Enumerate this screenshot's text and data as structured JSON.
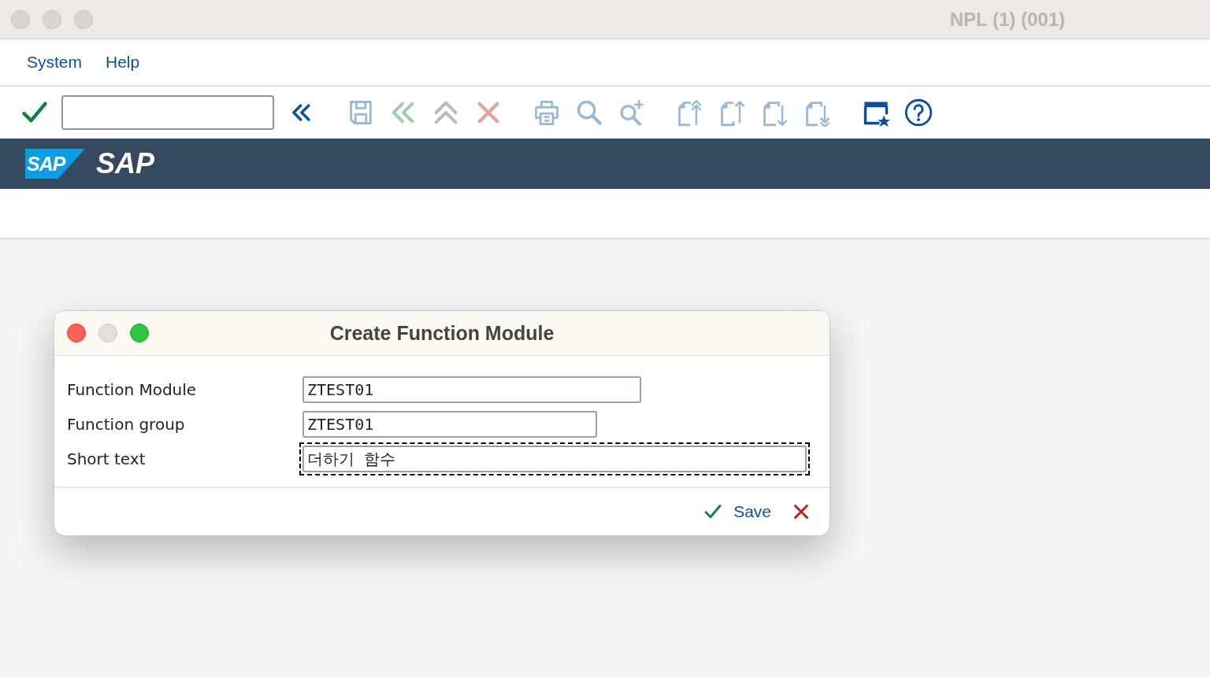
{
  "window": {
    "title": "NPL (1) (001)"
  },
  "menu": [
    {
      "label": "System"
    },
    {
      "label": "Help"
    }
  ],
  "toolbar": {
    "items": [
      {
        "kind": "check",
        "disabled": false
      },
      {
        "kind": "command-field"
      },
      {
        "kind": "expand",
        "disabled": false
      },
      {
        "kind": "save",
        "disabled": true
      },
      {
        "kind": "back",
        "disabled": true
      },
      {
        "kind": "up",
        "disabled": true
      },
      {
        "kind": "cancel",
        "disabled": true
      },
      {
        "kind": "print",
        "disabled": true
      },
      {
        "kind": "find",
        "disabled": true
      },
      {
        "kind": "find-next",
        "disabled": true
      },
      {
        "kind": "first-page",
        "disabled": true
      },
      {
        "kind": "prev-page",
        "disabled": true
      },
      {
        "kind": "next-page",
        "disabled": true
      },
      {
        "kind": "last-page",
        "disabled": true
      },
      {
        "kind": "layout",
        "disabled": false
      },
      {
        "kind": "help",
        "disabled": false
      }
    ]
  },
  "header": {
    "logo_text": "SAP",
    "title": "SAP"
  },
  "dialog": {
    "title": "Create Function Module",
    "fields": [
      {
        "label": "Function Module",
        "value": "ZTEST01",
        "focused": false
      },
      {
        "label": "Function group",
        "value": "ZTEST01",
        "focused": false
      },
      {
        "label": "Short text",
        "value": "더하기 함수",
        "focused": true
      }
    ],
    "buttons": [
      {
        "kind": "confirm",
        "label": "Save"
      },
      {
        "kind": "cancel"
      }
    ]
  }
}
